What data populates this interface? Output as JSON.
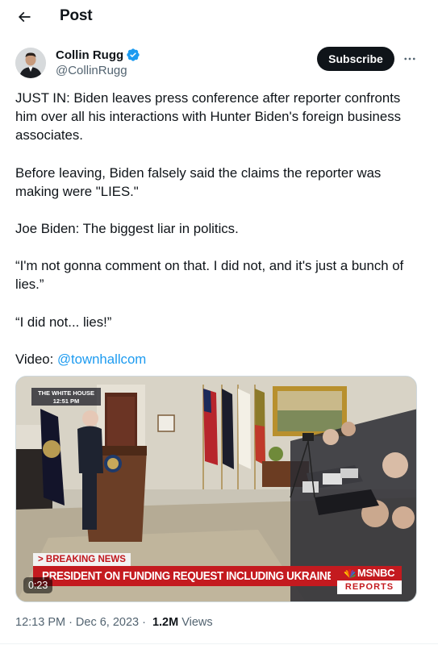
{
  "header": {
    "title": "Post"
  },
  "author": {
    "display_name": "Collin Rugg",
    "handle": "@CollinRugg",
    "verified": true
  },
  "actions": {
    "subscribe_label": "Subscribe"
  },
  "tweet": {
    "paragraphs": [
      "JUST IN: Biden leaves press conference after reporter confronts him over all his interactions with Hunter Biden's foreign business associates.",
      "Before leaving, Biden falsely said the claims the reporter was making were \"LIES.\"",
      "Joe Biden: The biggest liar in politics.",
      "“I'm not gonna comment on that. I did not, and it's just a bunch of lies.”",
      "“I did not... lies!”"
    ],
    "video_prefix": "Video: ",
    "video_link": "@townhallcom"
  },
  "media": {
    "location_badge_line1": "THE WHITE HOUSE",
    "location_badge_line2": "12:51 PM",
    "breaking_label": "> BREAKING NEWS",
    "headline": "PRESIDENT ON FUNDING REQUEST INCLUDING UKRAINE AID",
    "network": "MSNBC",
    "network_sub": "REPORTS",
    "timer": "0:23"
  },
  "meta": {
    "time": "12:13 PM",
    "separator": "·",
    "date": "Dec 6, 2023",
    "views_count": "1.2M",
    "views_label": "Views"
  },
  "colors": {
    "accent": "#1d9bf0",
    "text": "#0f1419",
    "secondary": "#536471",
    "breaking_red": "#c41a1f"
  },
  "icons": {
    "back": "arrow-left-icon",
    "verified": "verified-badge-icon",
    "more": "more-horizontal-icon",
    "network_logo": "peacock-icon"
  }
}
